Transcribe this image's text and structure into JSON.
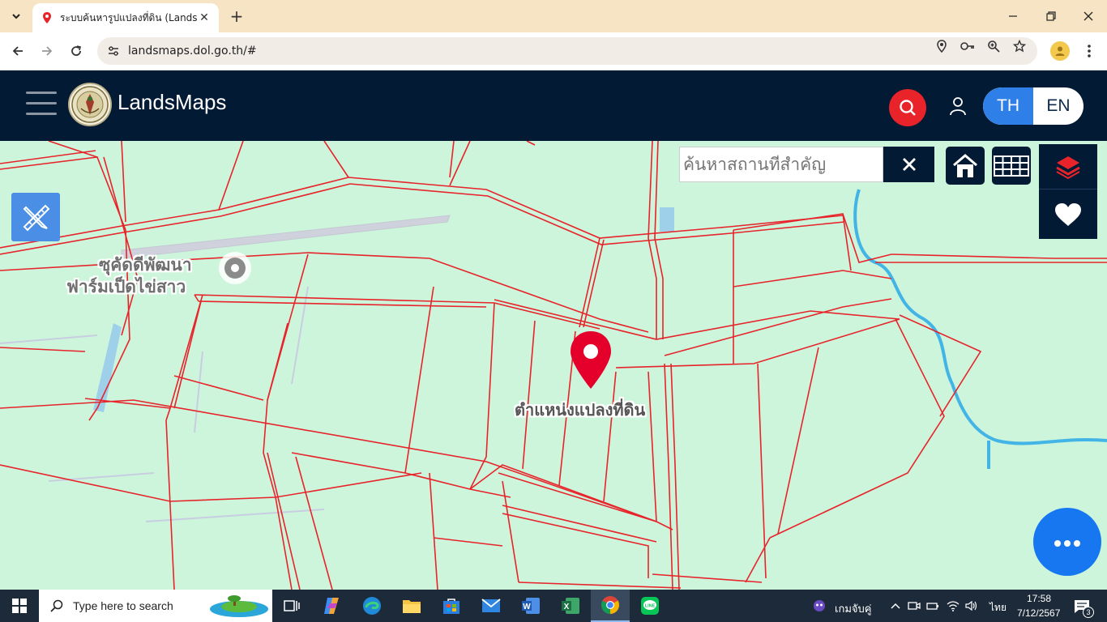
{
  "browser": {
    "tab_title": "ระบบค้นหารูปแปลงที่ดิน (LandsMap",
    "url": "landsmaps.dol.go.th/#"
  },
  "header": {
    "brand": "LandsMaps",
    "lang_th": "TH",
    "lang_en": "EN"
  },
  "map": {
    "search_placeholder": "ค้นหาสถานที่สำคัญ",
    "poi_line1": "ซุคัดดีพัฒนา",
    "poi_line2": "ฟาร์มเป็ดไข่สาว",
    "pin_label": "ตำแหน่งแปลงที่ดิน"
  },
  "taskbar": {
    "search_text": "Type here to search",
    "tray_app_label": "เกมจับคู่",
    "ime": "ไทย",
    "time": "17:58",
    "date": "7/12/2567",
    "notifications": "3"
  },
  "colors": {
    "header_bg": "#031a35",
    "map_bg": "#ccf5dc",
    "parcel_line": "#e8232a",
    "accent_blue": "#2f7fe8",
    "search_red": "#e8232a"
  }
}
